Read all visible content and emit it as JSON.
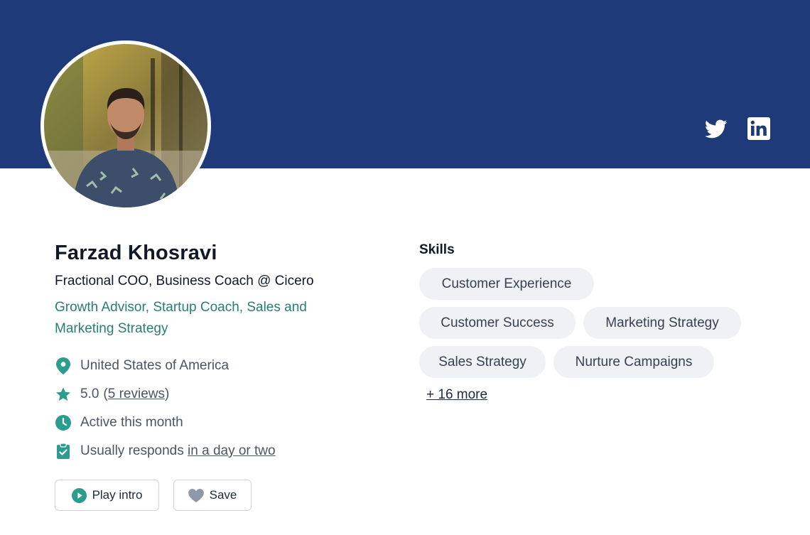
{
  "profile": {
    "name": "Farzad Khosravi",
    "headline": "Fractional COO, Business Coach @ Cicero",
    "tagline": "Growth Advisor, Startup Coach, Sales and Marketing Strategy"
  },
  "info": {
    "location": "United States of America",
    "rating": "5.0",
    "reviews_open": "(",
    "reviews_link": "5 reviews",
    "reviews_close": ")",
    "activity": "Active this month",
    "responds_prefix": "Usually responds ",
    "responds_link": "in a day or two"
  },
  "actions": {
    "play_label": "Play intro",
    "save_label": "Save"
  },
  "skills": {
    "title": "Skills",
    "items": [
      "Customer Experience",
      "Customer Success",
      "Marketing Strategy",
      "Sales Strategy",
      "Nurture Campaigns"
    ],
    "more_label": "+ 16 more"
  },
  "social": {
    "icons": [
      "twitter-icon",
      "linkedin-icon"
    ]
  },
  "colors": {
    "banner": "#1e3a78",
    "accent": "#2a9d8f",
    "tagline": "#2a7d74",
    "chip_bg": "#f0f1f4"
  }
}
